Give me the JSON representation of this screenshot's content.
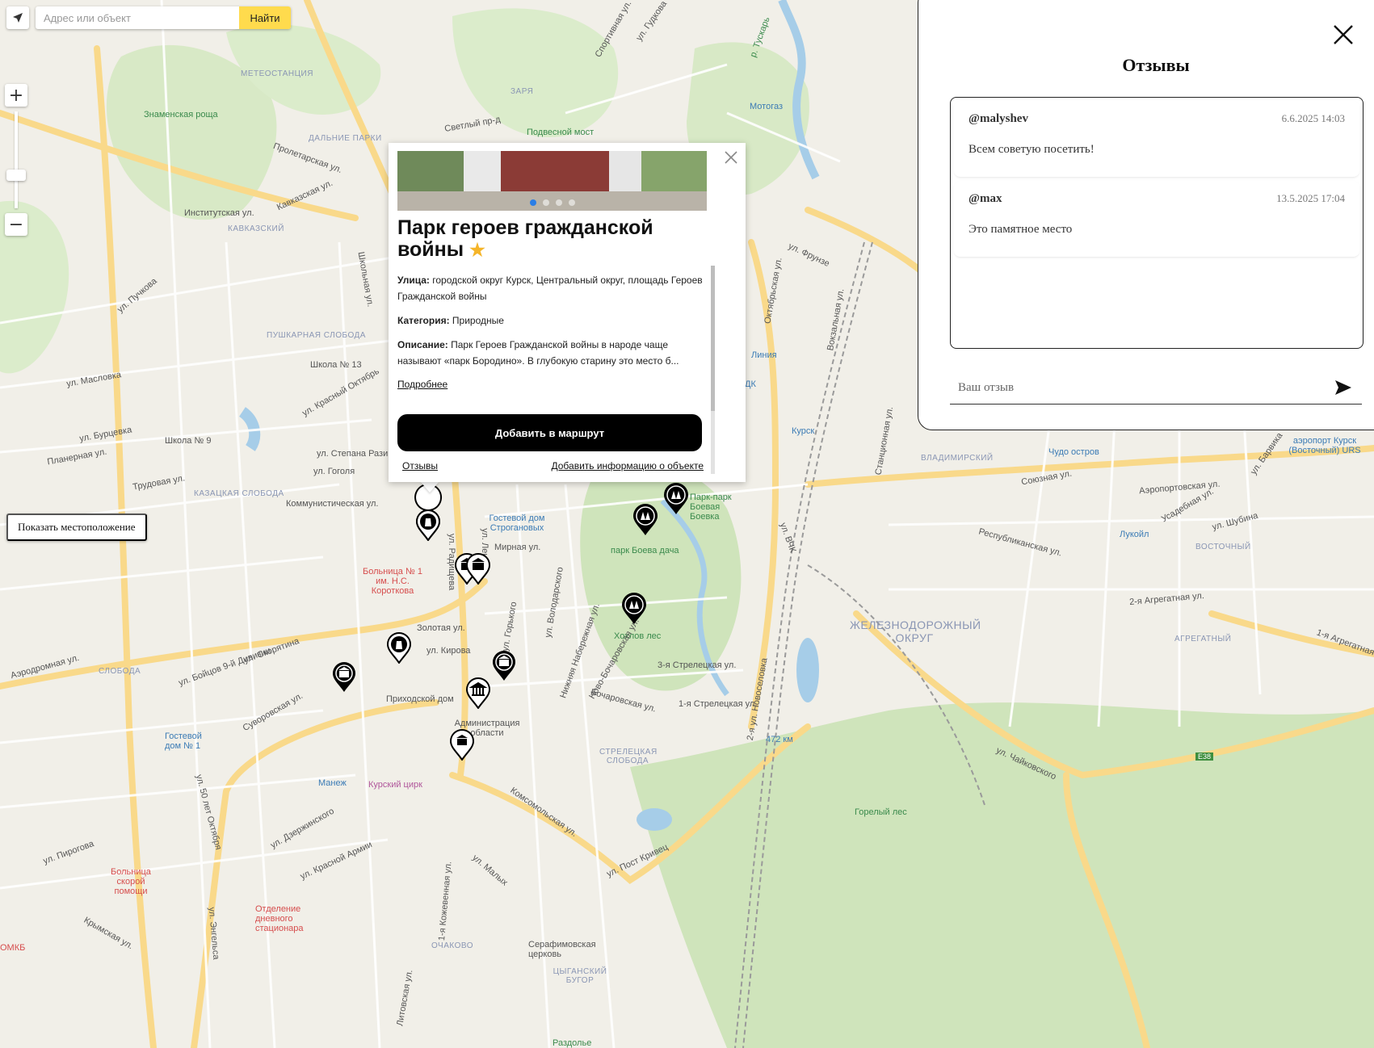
{
  "search": {
    "placeholder": "Адрес или объект",
    "button_label": "Найти"
  },
  "map": {
    "show_location_label": "Показать местоположение",
    "labels": [
      "ул. Гудкова",
      "Спортивная ул.",
      "р. Тускарь",
      "Мотогаз",
      "Знаменская роща",
      "МЕТЕОСТАНЦИЯ",
      "ЗАРЯ",
      "Светлый пр-д",
      "Подвесной мост",
      "ДАЛЬНИЕ ПАРКИ",
      "Пролетарская ул.",
      "Кавказская ул.",
      "Институтская ул.",
      "КАВКАЗСКИЙ",
      "ул. Пучкова",
      "Школьная ул.",
      "ПУШКАРНАЯ СЛОБОДА",
      "Школа № 13",
      "ул. Красный Октябрь",
      "ул. Масловка",
      "ул. Бурцевка",
      "Школа № 9",
      "Планерная ул.",
      "Трудовая ул.",
      "КАЗАЦКАЯ СЛОБОДА",
      "ул. Степана Разина",
      "ул. Гоголя",
      "Коммунистическая ул.",
      "Больница № 1 им. Н.С. Короткова",
      "Гостевой дом Строгановых",
      "Мирная ул.",
      "парк Боева дача",
      "Парк-парк Боевая Боевка",
      "Хохлов лес",
      "3-я Стрелецкая ул.",
      "1-я Стрелецкая ул.",
      "Золотая ул.",
      "ул. Кирова",
      "Приходской дом",
      "Администрация области",
      "ул. Радищева",
      "ул. Ленина",
      "ул. Горького",
      "ул. Володарского",
      "Нижняя Набережная ул.",
      "Ново-Бочаровская ул.",
      "Бочаровская ул.",
      "СЛОБОДА",
      "ул. Скорятина",
      "Аэродромная ул.",
      "ул. Бойцов 9-й Дивизии",
      "Гостевой дом № 1",
      "Манеж",
      "Курский цирк",
      "ул. Дзержинского",
      "ул. Красной Армии",
      "Суворовская ул.",
      "ул. 50 лет Октября",
      "Больница скорой помощи",
      "Отделение дневного стационара",
      "ул. Энгельса",
      "ул. Пирогова",
      "Крымская ул.",
      "1-я Кожевенная ул.",
      "Литовская ул.",
      "ул. Малых",
      "ОЧАКОВО",
      "Серафимовская церковь",
      "ЦЫГАНСКИЙ БУГОР",
      "Раздолье",
      "СТРЕЛЕЦКАЯ СЛОБОДА",
      "Комсомольская ул.",
      "ул. Пост Кривец",
      "2-я ул. Новоселовка",
      "ул. Фрунзе",
      "Октябрьская ул.",
      "Вокзальная ул.",
      "Линия",
      "ДК",
      "Курск",
      "Станционная ул.",
      "ВЛАДИМИРСКИЙ",
      "Чудо остров",
      "Союзная ул.",
      "ул. ВЧК",
      "Республиканская ул.",
      "ЖЕЛЕЗНОДОРОЖНЫЙ ОКРУГ",
      "ул. Чайковского",
      "472 км",
      "E38",
      "Горелый лес",
      "Лукойл",
      "ВОСТОЧНЫЙ",
      "2-я Агрегатная ул.",
      "АГРЕГАТНЫЙ",
      "1-я Агрегатная",
      "Аэропортовская ул.",
      "аэропорт Курск (Восточный) URS",
      "ул. Шубина",
      "Усадебная ул.",
      "ул. Барвика",
      "ОМКБ"
    ]
  },
  "balloon": {
    "title": "Парк героев гражданской войны",
    "street_label": "Улица:",
    "street_value": "городской округ Курск, Центральный округ, площадь Героев Гражданской войны",
    "category_label": "Категория:",
    "category_value": "Природные",
    "description_label": "Описание:",
    "description_value": "Парк Героев Гражданской войны в народе чаще называют «парк Бородино». В глубокую старину это место б...",
    "more_label": "Подробнее",
    "route_button": "Добавить в маршрут",
    "reviews_link": "Отзывы",
    "add_info_link": "Добавить информацию о объекте",
    "photos_count": 4,
    "active_photo": 1
  },
  "reviews_panel": {
    "title": "Отзывы",
    "reviews": [
      {
        "user": "@malyshev",
        "date": "6.6.2025 14:03",
        "text": "Всем советую посетить!"
      },
      {
        "user": "@max",
        "date": "13.5.2025 17:04",
        "text": "Это памятное место"
      }
    ],
    "input_placeholder": "Ваш отзыв"
  },
  "colors": {
    "accent_yellow": "#ffdb4d",
    "route_button": "#000000",
    "dot_active": "#2a7ee6"
  }
}
